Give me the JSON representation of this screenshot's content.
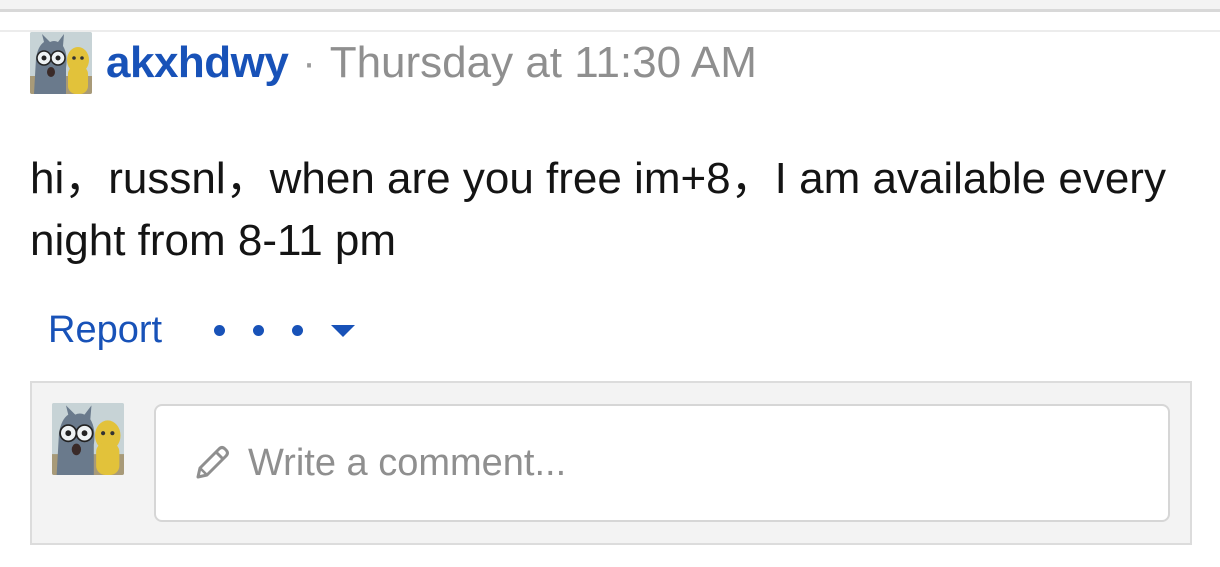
{
  "post": {
    "author": "akxhdwy",
    "separator": "·",
    "timestamp": "Thursday at 11:30 AM",
    "message": "hi，russnl，when are you free im+8，I am available every night from 8-11 pm"
  },
  "actions": {
    "report_label": "Report",
    "more_icon": "ellipsis-dropdown-icon"
  },
  "comment": {
    "placeholder": "Write a comment...",
    "icon": "pencil-icon"
  },
  "colors": {
    "link": "#1852b8",
    "muted": "#8f8f8f",
    "text": "#141414",
    "panel": "#f3f3f3"
  }
}
